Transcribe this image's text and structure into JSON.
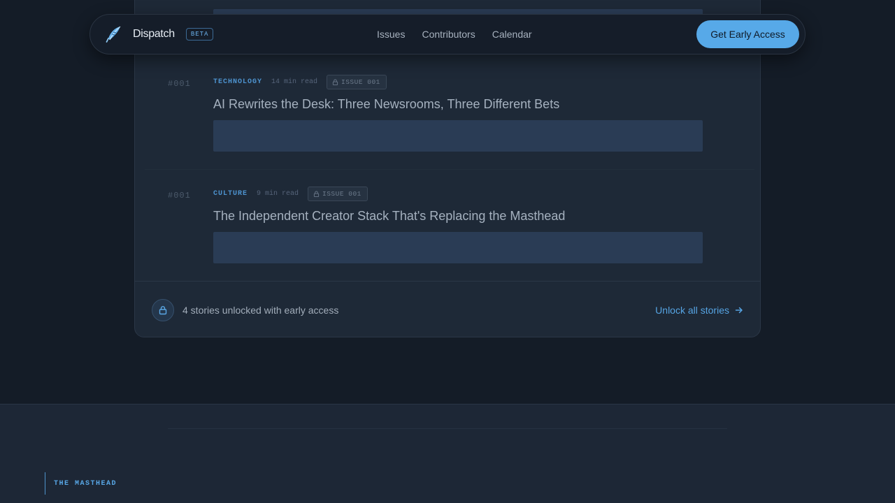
{
  "nav": {
    "brand": "Dispatch",
    "badge": "BETA",
    "links": [
      "Issues",
      "Contributors",
      "Calendar"
    ],
    "cta": "Get Early Access"
  },
  "stories": [
    {
      "number": "#001",
      "category": "TECHNOLOGY",
      "read_time": "14 min read",
      "issue": "ISSUE 001",
      "title": "AI Rewrites the Desk: Three Newsrooms, Three Different Bets"
    },
    {
      "number": "#001",
      "category": "CULTURE",
      "read_time": "9 min read",
      "issue": "ISSUE 001",
      "title": "The Independent Creator Stack That's Replacing the Masthead"
    }
  ],
  "unlock": {
    "text": "4 stories unlocked with early access",
    "link": "Unlock all stories"
  },
  "footer": {
    "section_label": "THE MASTHEAD"
  },
  "colors": {
    "accent": "#57a9e8",
    "background": "#141c27",
    "panel": "#1e2937",
    "placeholder_block": "#2a3c55"
  },
  "icons": {
    "brand": "quill-icon",
    "badge_lock": "lock-icon",
    "unlock_lock": "lock-icon",
    "unlock_arrow": "arrow-right-icon"
  }
}
